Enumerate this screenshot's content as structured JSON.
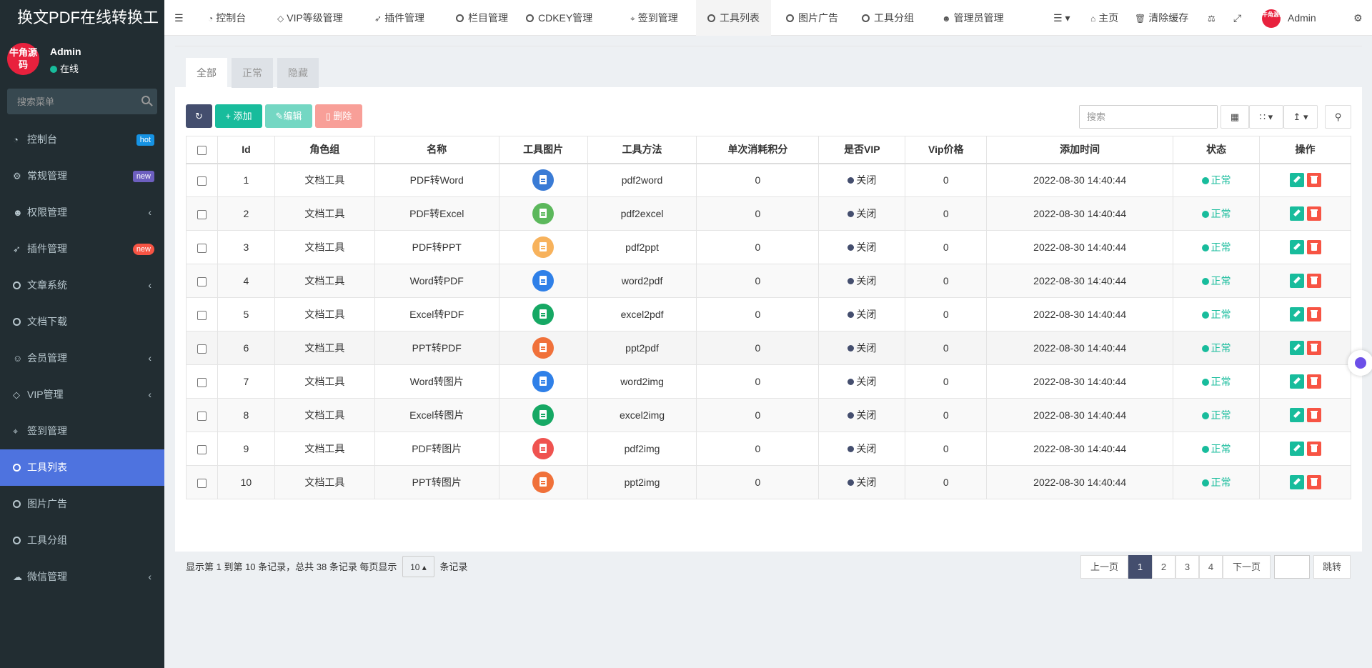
{
  "app": {
    "title": "换文PDF在线转换工"
  },
  "user": {
    "name": "Admin",
    "status": "在线",
    "avatar_text": "牛角源码"
  },
  "sidebar": {
    "search_placeholder": "搜索菜单",
    "items": [
      {
        "label": "控制台",
        "icon": "dashboard-icon",
        "badge": "hot",
        "badge_color": "#1693e4"
      },
      {
        "label": "常规管理",
        "icon": "cogs-icon",
        "badge": "new",
        "badge_color": "#6d5fbf"
      },
      {
        "label": "权限管理",
        "icon": "group-icon",
        "chevron": true
      },
      {
        "label": "插件管理",
        "icon": "rocket-icon",
        "badge": "new",
        "badge_color": "#f75444"
      },
      {
        "label": "文章系统",
        "icon": "circle-icon",
        "chevron": true
      },
      {
        "label": "文档下载",
        "icon": "circle-icon"
      },
      {
        "label": "会员管理",
        "icon": "user-circle-icon",
        "chevron": true
      },
      {
        "label": "VIP管理",
        "icon": "diamond-icon",
        "chevron": true
      },
      {
        "label": "签到管理",
        "icon": "map-marker-icon"
      },
      {
        "label": "工具列表",
        "icon": "circle-icon",
        "active": true
      },
      {
        "label": "图片广告",
        "icon": "circle-icon"
      },
      {
        "label": "工具分组",
        "icon": "circle-icon"
      },
      {
        "label": "微信管理",
        "icon": "wechat-icon",
        "chevron": true
      }
    ]
  },
  "topnav": {
    "tabs": [
      {
        "label": "控制台",
        "icon": "dashboard-icon"
      },
      {
        "label": "VIP等级管理",
        "icon": "diamond-icon"
      },
      {
        "label": "插件管理",
        "icon": "rocket-icon"
      },
      {
        "label": "栏目管理",
        "icon": "circle-icon"
      },
      {
        "label": "CDKEY管理",
        "icon": "circle-icon"
      },
      {
        "label": "签到管理",
        "icon": "map-marker-icon"
      },
      {
        "label": "工具列表",
        "icon": "circle-icon",
        "active": true
      },
      {
        "label": "图片广告",
        "icon": "circle-icon"
      },
      {
        "label": "工具分组",
        "icon": "circle-icon"
      },
      {
        "label": "管理员管理",
        "icon": "user-icon"
      }
    ],
    "home_label": "主页",
    "clear_cache_label": "清除缓存",
    "admin_label": "Admin"
  },
  "filter_tabs": [
    "全部",
    "正常",
    "隐藏"
  ],
  "toolbar": {
    "add_label": "添加",
    "edit_label": "编辑",
    "delete_label": "删除",
    "search_placeholder": "搜索"
  },
  "table": {
    "columns": [
      "Id",
      "角色组",
      "名称",
      "工具图片",
      "工具方法",
      "单次消耗积分",
      "是否VIP",
      "Vip价格",
      "添加时间",
      "状态",
      "操作"
    ],
    "rows": [
      {
        "id": "1",
        "group": "文档工具",
        "name": "PDF转Word",
        "icon_color": "#3a7bd5",
        "method": "pdf2word",
        "points": "0",
        "vip": "关闭",
        "vip_price": "0",
        "time": "2022-08-30 14:40:44",
        "status": "正常"
      },
      {
        "id": "2",
        "group": "文档工具",
        "name": "PDF转Excel",
        "icon_color": "#5cb85c",
        "method": "pdf2excel",
        "points": "0",
        "vip": "关闭",
        "vip_price": "0",
        "time": "2022-08-30 14:40:44",
        "status": "正常"
      },
      {
        "id": "3",
        "group": "文档工具",
        "name": "PDF转PPT",
        "icon_color": "#f7b25c",
        "method": "pdf2ppt",
        "points": "0",
        "vip": "关闭",
        "vip_price": "0",
        "time": "2022-08-30 14:40:44",
        "status": "正常"
      },
      {
        "id": "4",
        "group": "文档工具",
        "name": "Word转PDF",
        "icon_color": "#2f80e8",
        "method": "word2pdf",
        "points": "0",
        "vip": "关闭",
        "vip_price": "0",
        "time": "2022-08-30 14:40:44",
        "status": "正常"
      },
      {
        "id": "5",
        "group": "文档工具",
        "name": "Excel转PDF",
        "icon_color": "#16a864",
        "method": "excel2pdf",
        "points": "0",
        "vip": "关闭",
        "vip_price": "0",
        "time": "2022-08-30 14:40:44",
        "status": "正常"
      },
      {
        "id": "6",
        "group": "文档工具",
        "name": "PPT转PDF",
        "icon_color": "#f0713a",
        "method": "ppt2pdf",
        "points": "0",
        "vip": "关闭",
        "vip_price": "0",
        "time": "2022-08-30 14:40:44",
        "status": "正常"
      },
      {
        "id": "7",
        "group": "文档工具",
        "name": "Word转图片",
        "icon_color": "#2f80e8",
        "method": "word2img",
        "points": "0",
        "vip": "关闭",
        "vip_price": "0",
        "time": "2022-08-30 14:40:44",
        "status": "正常"
      },
      {
        "id": "8",
        "group": "文档工具",
        "name": "Excel转图片",
        "icon_color": "#16a864",
        "method": "excel2img",
        "points": "0",
        "vip": "关闭",
        "vip_price": "0",
        "time": "2022-08-30 14:40:44",
        "status": "正常"
      },
      {
        "id": "9",
        "group": "文档工具",
        "name": "PDF转图片",
        "icon_color": "#ef5350",
        "method": "pdf2img",
        "points": "0",
        "vip": "关闭",
        "vip_price": "0",
        "time": "2022-08-30 14:40:44",
        "status": "正常"
      },
      {
        "id": "10",
        "group": "文档工具",
        "name": "PPT转图片",
        "icon_color": "#f0713a",
        "method": "ppt2img",
        "points": "0",
        "vip": "关闭",
        "vip_price": "0",
        "time": "2022-08-30 14:40:44",
        "status": "正常"
      }
    ]
  },
  "pagination": {
    "info_prefix": "显示第 1 到第 10 条记录，总共 38 条记录 每页显示",
    "page_size": "10",
    "info_suffix": "条记录",
    "prev_label": "上一页",
    "pages": [
      "1",
      "2",
      "3",
      "4"
    ],
    "current_page": "1",
    "next_label": "下一页",
    "jump_label": "跳转"
  }
}
